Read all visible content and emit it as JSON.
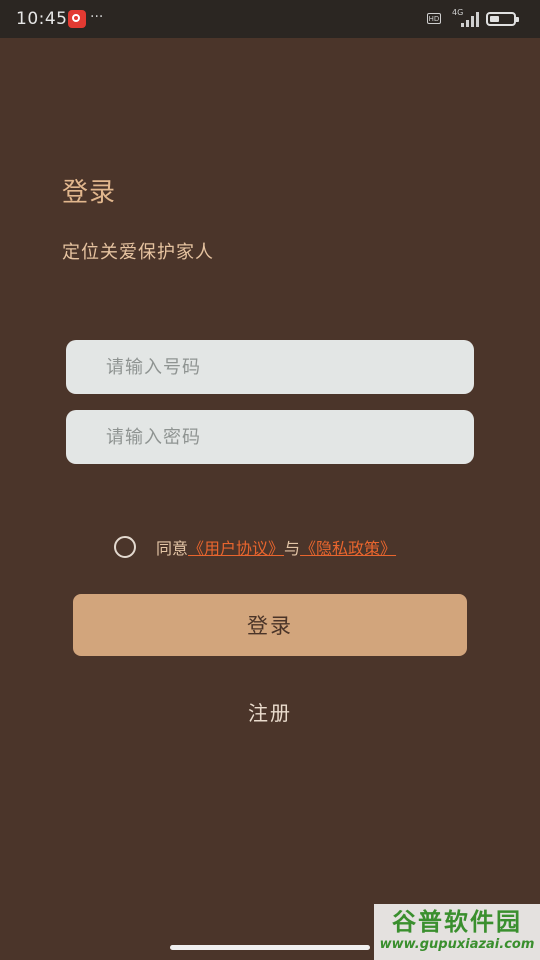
{
  "status_bar": {
    "time": "10:45",
    "dots": "···",
    "hd_label": "HD",
    "network": "4G",
    "app_icon": "netease-music-icon",
    "signal_icon": "signal-icon",
    "battery_icon": "battery-icon"
  },
  "login": {
    "title": "登录",
    "subtitle": "定位关爱保护家人",
    "phone_placeholder": "请输入号码",
    "password_placeholder": "请输入密码",
    "agree_prefix": "同意",
    "user_agreement": "《用户协议》",
    "agree_conjunction": "与",
    "privacy_policy": "《隐私政策》",
    "login_button": "登录",
    "register_link": "注册"
  },
  "watermark": {
    "name": "谷普软件园",
    "url": "www.gupuxiazai.com"
  },
  "colors": {
    "background": "#4b352a",
    "accent": "#d2a57c",
    "link": "#e8652e"
  }
}
